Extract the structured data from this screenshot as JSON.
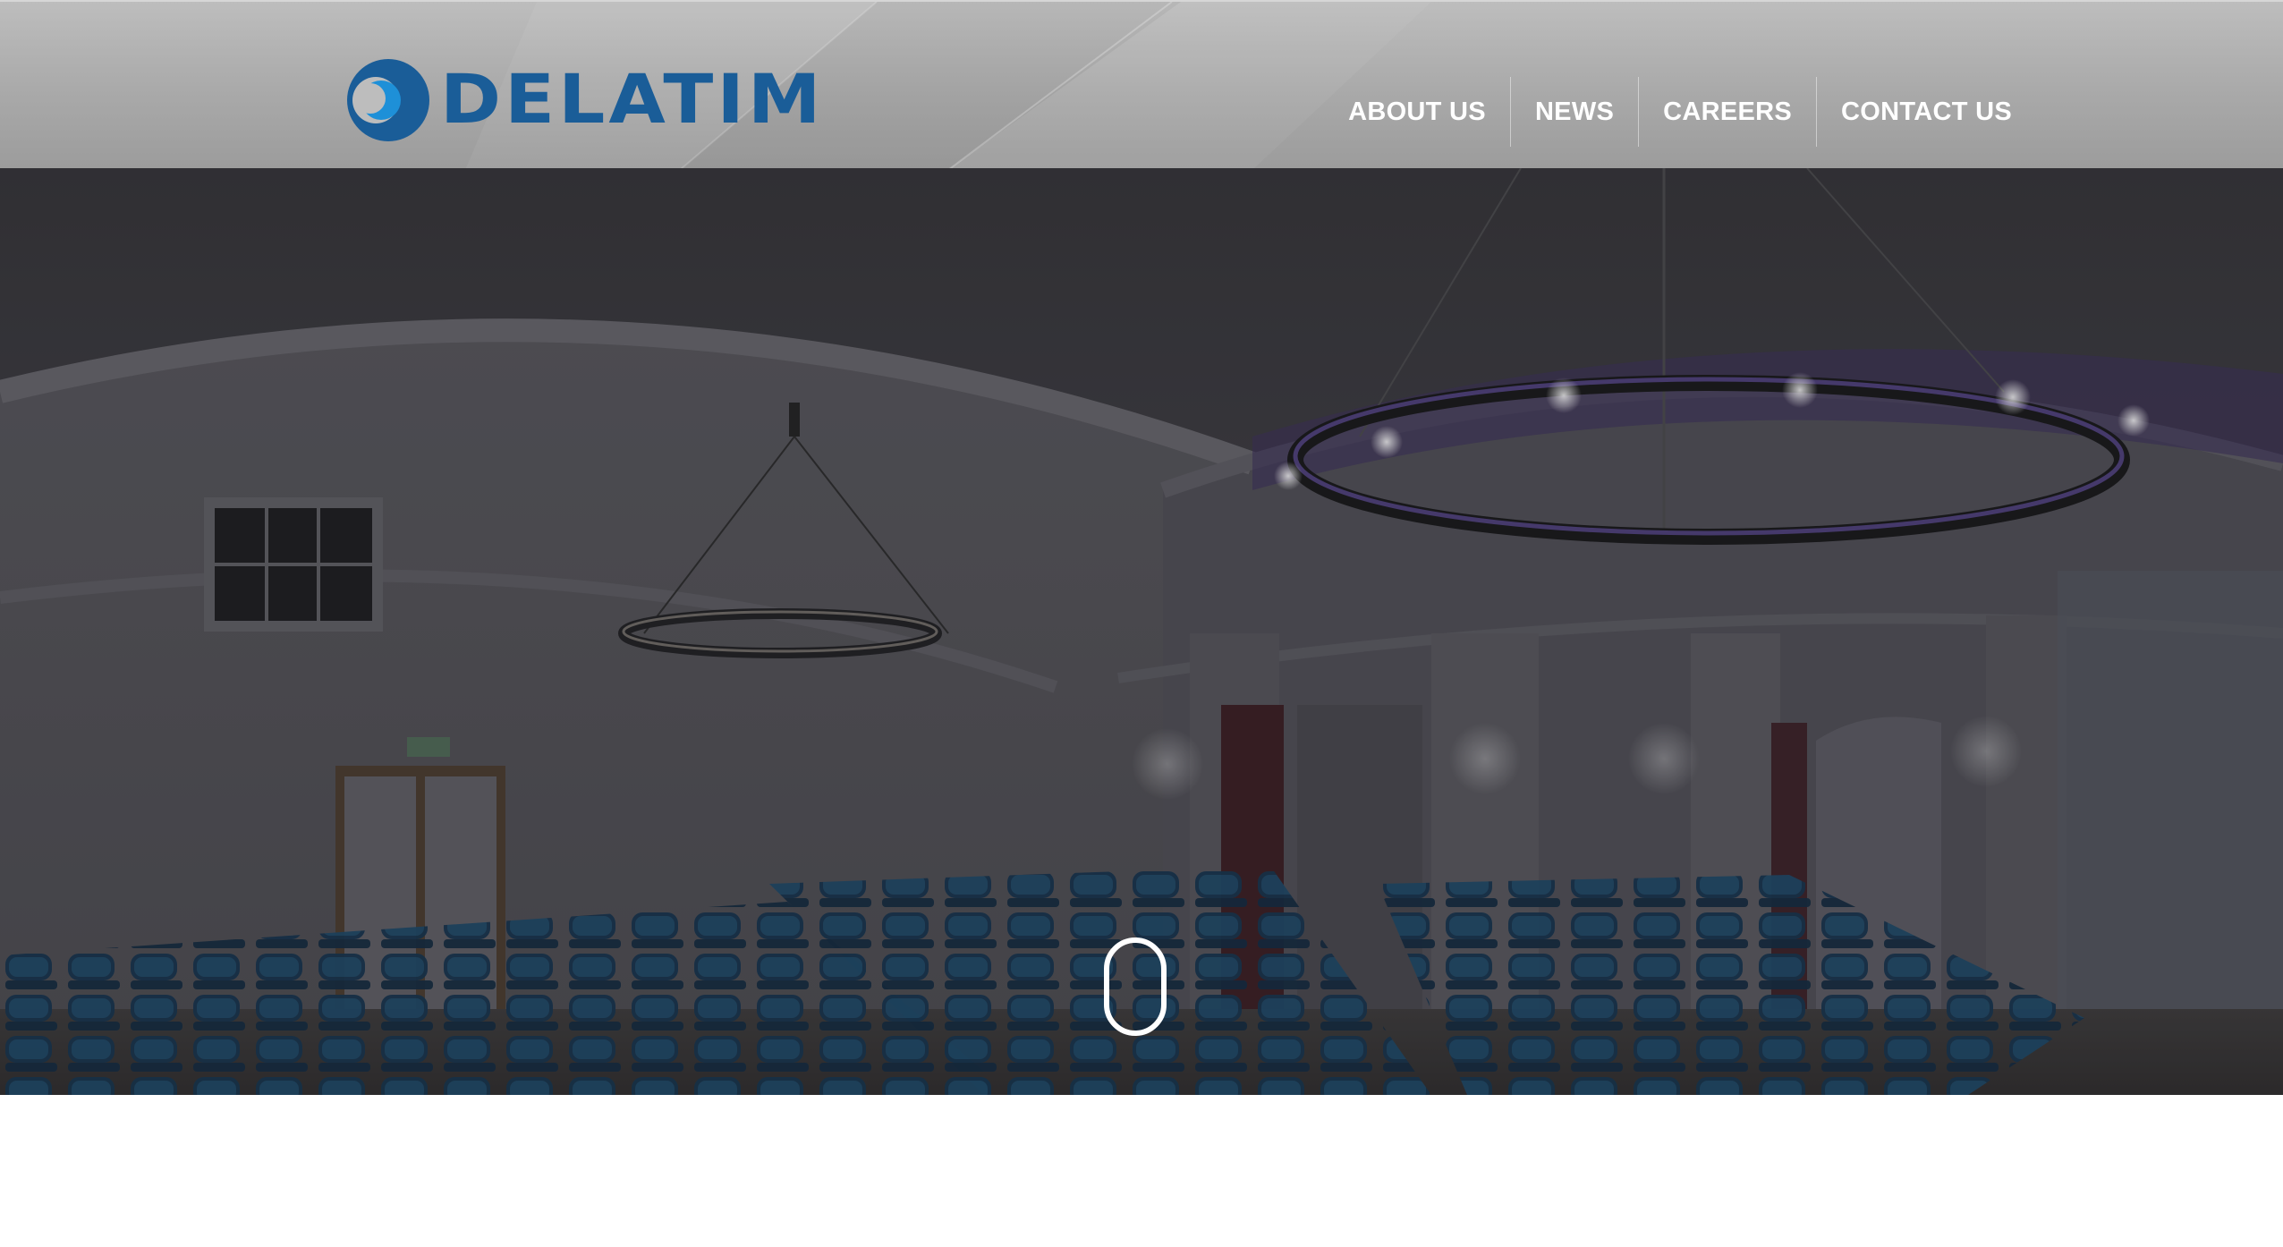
{
  "brand": {
    "name": "DELATIM",
    "logo_color": "#1a5d98",
    "logo_accent": "#1e90d8"
  },
  "nav": {
    "items": [
      {
        "label": "ABOUT US"
      },
      {
        "label": "NEWS"
      },
      {
        "label": "CAREERS"
      },
      {
        "label": "CONTACT US"
      }
    ]
  },
  "hero": {
    "image_icon": "event-hall-photo",
    "overlay_color": "#2b2b30",
    "scroll_icon": "mouse-scroll-icon"
  }
}
